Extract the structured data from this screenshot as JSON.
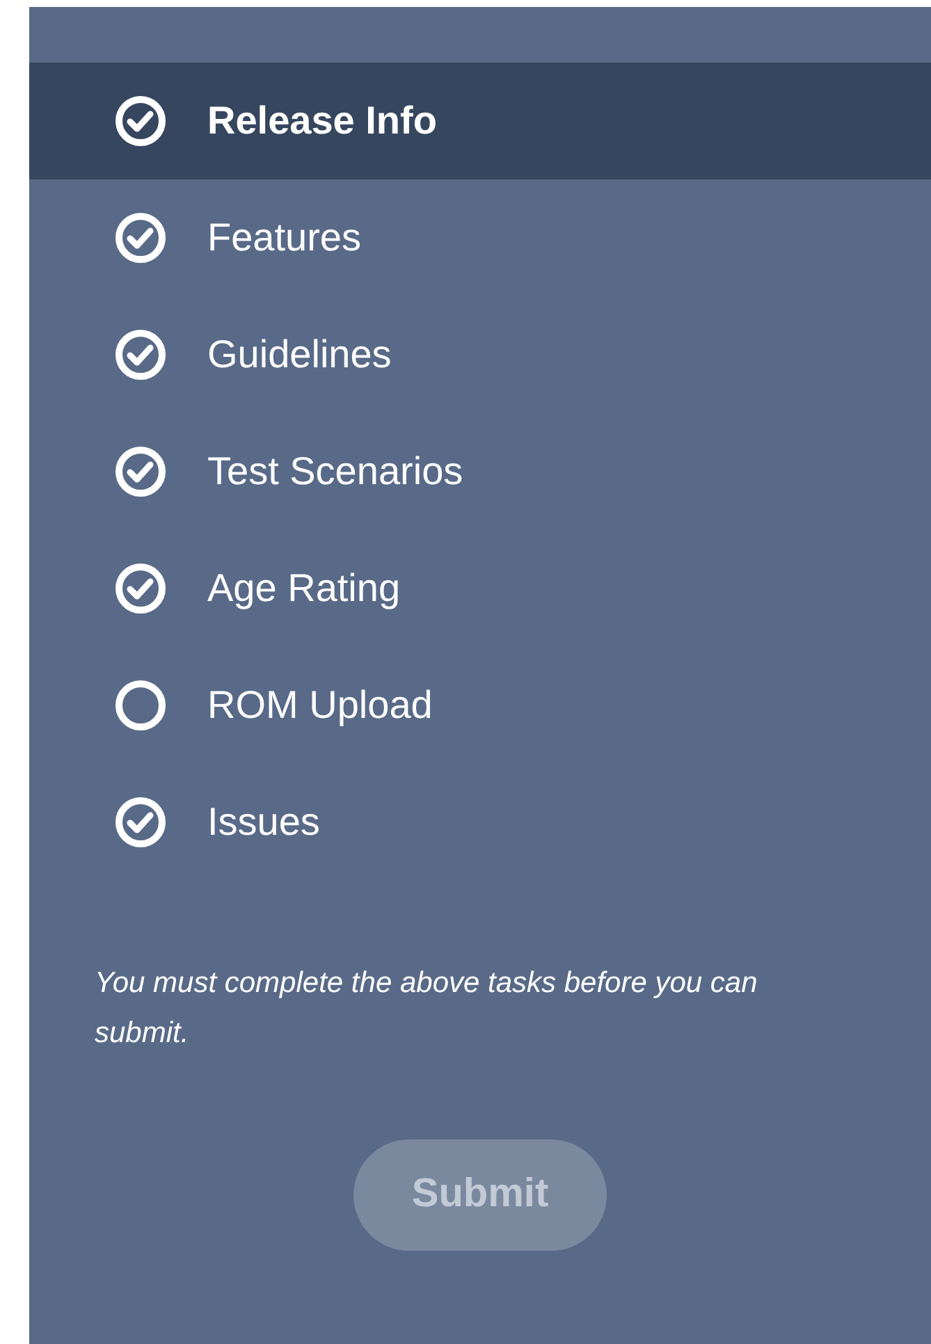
{
  "steps": [
    {
      "label": "Release Info",
      "completed": true,
      "selected": true
    },
    {
      "label": "Features",
      "completed": true,
      "selected": false
    },
    {
      "label": "Guidelines",
      "completed": true,
      "selected": false
    },
    {
      "label": "Test Scenarios",
      "completed": true,
      "selected": false
    },
    {
      "label": "Age Rating",
      "completed": true,
      "selected": false
    },
    {
      "label": "ROM Upload",
      "completed": false,
      "selected": false
    },
    {
      "label": "Issues",
      "completed": true,
      "selected": false
    }
  ],
  "note": "You must complete the above tasks before you can submit.",
  "submit_button": {
    "label": "Submit",
    "disabled": true
  }
}
